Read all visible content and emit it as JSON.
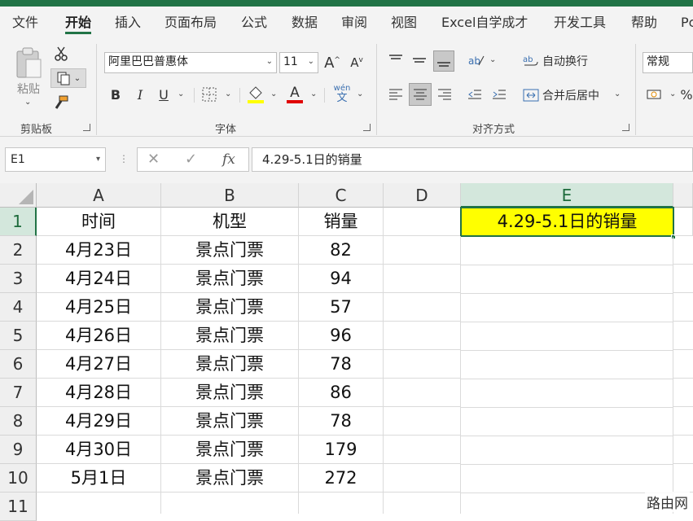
{
  "tabs": [
    "文件",
    "开始",
    "插入",
    "页面布局",
    "公式",
    "数据",
    "审阅",
    "视图",
    "Excel自学成才",
    "开发工具",
    "帮助",
    "Pc"
  ],
  "active_tab": "开始",
  "ribbon": {
    "clipboard": {
      "paste_label": "粘贴",
      "group_label": "剪贴板"
    },
    "font": {
      "font_name": "阿里巴巴普惠体",
      "font_size": "11",
      "bold": "B",
      "italic": "I",
      "underline": "U",
      "wen": "wén",
      "wen_char": "文",
      "group_label": "字体"
    },
    "alignment": {
      "wrap_text": "自动换行",
      "merge_center": "合并后居中",
      "group_label": "对齐方式"
    },
    "number": {
      "format": "常规"
    }
  },
  "formula_bar": {
    "name_box": "E1",
    "fx": "fx",
    "content": "4.29-5.1日的销量"
  },
  "columns": [
    "A",
    "B",
    "C",
    "D",
    "E"
  ],
  "rows": [
    "1",
    "2",
    "3",
    "4",
    "5",
    "6",
    "7",
    "8",
    "9",
    "10",
    "11"
  ],
  "headers": {
    "a": "时间",
    "b": "机型",
    "c": "销量"
  },
  "data": [
    {
      "date": "4月23日",
      "type": "景点门票",
      "sales": "82"
    },
    {
      "date": "4月24日",
      "type": "景点门票",
      "sales": "94"
    },
    {
      "date": "4月25日",
      "type": "景点门票",
      "sales": "57"
    },
    {
      "date": "4月26日",
      "type": "景点门票",
      "sales": "96"
    },
    {
      "date": "4月27日",
      "type": "景点门票",
      "sales": "78"
    },
    {
      "date": "4月28日",
      "type": "景点门票",
      "sales": "86"
    },
    {
      "date": "4月29日",
      "type": "景点门票",
      "sales": "78"
    },
    {
      "date": "4月30日",
      "type": "景点门票",
      "sales": "179"
    },
    {
      "date": "5月1日",
      "type": "景点门票",
      "sales": "272"
    }
  ],
  "active_cell": {
    "ref": "E1",
    "value": "4.29-5.1日的销量",
    "fill": "#ffff00"
  },
  "watermark": "路由网",
  "colors": {
    "accent": "#217346",
    "highlight": "#ffff00",
    "font_color": "#e00000"
  }
}
